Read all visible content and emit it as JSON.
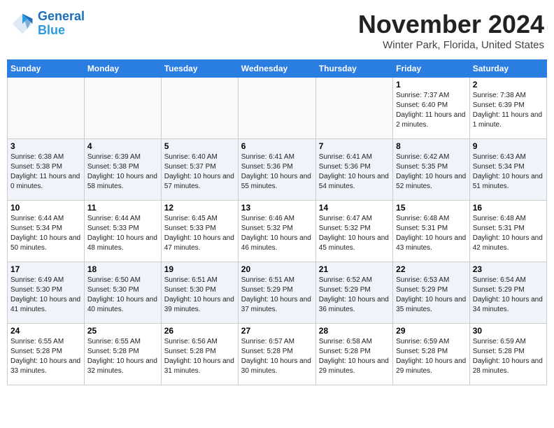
{
  "header": {
    "logo_line1": "General",
    "logo_line2": "Blue",
    "month": "November 2024",
    "location": "Winter Park, Florida, United States"
  },
  "weekdays": [
    "Sunday",
    "Monday",
    "Tuesday",
    "Wednesday",
    "Thursday",
    "Friday",
    "Saturday"
  ],
  "weeks": [
    [
      {
        "day": "",
        "info": ""
      },
      {
        "day": "",
        "info": ""
      },
      {
        "day": "",
        "info": ""
      },
      {
        "day": "",
        "info": ""
      },
      {
        "day": "",
        "info": ""
      },
      {
        "day": "1",
        "info": "Sunrise: 7:37 AM\nSunset: 6:40 PM\nDaylight: 11 hours and 2 minutes."
      },
      {
        "day": "2",
        "info": "Sunrise: 7:38 AM\nSunset: 6:39 PM\nDaylight: 11 hours and 1 minute."
      }
    ],
    [
      {
        "day": "3",
        "info": "Sunrise: 6:38 AM\nSunset: 5:38 PM\nDaylight: 11 hours and 0 minutes."
      },
      {
        "day": "4",
        "info": "Sunrise: 6:39 AM\nSunset: 5:38 PM\nDaylight: 10 hours and 58 minutes."
      },
      {
        "day": "5",
        "info": "Sunrise: 6:40 AM\nSunset: 5:37 PM\nDaylight: 10 hours and 57 minutes."
      },
      {
        "day": "6",
        "info": "Sunrise: 6:41 AM\nSunset: 5:36 PM\nDaylight: 10 hours and 55 minutes."
      },
      {
        "day": "7",
        "info": "Sunrise: 6:41 AM\nSunset: 5:36 PM\nDaylight: 10 hours and 54 minutes."
      },
      {
        "day": "8",
        "info": "Sunrise: 6:42 AM\nSunset: 5:35 PM\nDaylight: 10 hours and 52 minutes."
      },
      {
        "day": "9",
        "info": "Sunrise: 6:43 AM\nSunset: 5:34 PM\nDaylight: 10 hours and 51 minutes."
      }
    ],
    [
      {
        "day": "10",
        "info": "Sunrise: 6:44 AM\nSunset: 5:34 PM\nDaylight: 10 hours and 50 minutes."
      },
      {
        "day": "11",
        "info": "Sunrise: 6:44 AM\nSunset: 5:33 PM\nDaylight: 10 hours and 48 minutes."
      },
      {
        "day": "12",
        "info": "Sunrise: 6:45 AM\nSunset: 5:33 PM\nDaylight: 10 hours and 47 minutes."
      },
      {
        "day": "13",
        "info": "Sunrise: 6:46 AM\nSunset: 5:32 PM\nDaylight: 10 hours and 46 minutes."
      },
      {
        "day": "14",
        "info": "Sunrise: 6:47 AM\nSunset: 5:32 PM\nDaylight: 10 hours and 45 minutes."
      },
      {
        "day": "15",
        "info": "Sunrise: 6:48 AM\nSunset: 5:31 PM\nDaylight: 10 hours and 43 minutes."
      },
      {
        "day": "16",
        "info": "Sunrise: 6:48 AM\nSunset: 5:31 PM\nDaylight: 10 hours and 42 minutes."
      }
    ],
    [
      {
        "day": "17",
        "info": "Sunrise: 6:49 AM\nSunset: 5:30 PM\nDaylight: 10 hours and 41 minutes."
      },
      {
        "day": "18",
        "info": "Sunrise: 6:50 AM\nSunset: 5:30 PM\nDaylight: 10 hours and 40 minutes."
      },
      {
        "day": "19",
        "info": "Sunrise: 6:51 AM\nSunset: 5:30 PM\nDaylight: 10 hours and 39 minutes."
      },
      {
        "day": "20",
        "info": "Sunrise: 6:51 AM\nSunset: 5:29 PM\nDaylight: 10 hours and 37 minutes."
      },
      {
        "day": "21",
        "info": "Sunrise: 6:52 AM\nSunset: 5:29 PM\nDaylight: 10 hours and 36 minutes."
      },
      {
        "day": "22",
        "info": "Sunrise: 6:53 AM\nSunset: 5:29 PM\nDaylight: 10 hours and 35 minutes."
      },
      {
        "day": "23",
        "info": "Sunrise: 6:54 AM\nSunset: 5:29 PM\nDaylight: 10 hours and 34 minutes."
      }
    ],
    [
      {
        "day": "24",
        "info": "Sunrise: 6:55 AM\nSunset: 5:28 PM\nDaylight: 10 hours and 33 minutes."
      },
      {
        "day": "25",
        "info": "Sunrise: 6:55 AM\nSunset: 5:28 PM\nDaylight: 10 hours and 32 minutes."
      },
      {
        "day": "26",
        "info": "Sunrise: 6:56 AM\nSunset: 5:28 PM\nDaylight: 10 hours and 31 minutes."
      },
      {
        "day": "27",
        "info": "Sunrise: 6:57 AM\nSunset: 5:28 PM\nDaylight: 10 hours and 30 minutes."
      },
      {
        "day": "28",
        "info": "Sunrise: 6:58 AM\nSunset: 5:28 PM\nDaylight: 10 hours and 29 minutes."
      },
      {
        "day": "29",
        "info": "Sunrise: 6:59 AM\nSunset: 5:28 PM\nDaylight: 10 hours and 29 minutes."
      },
      {
        "day": "30",
        "info": "Sunrise: 6:59 AM\nSunset: 5:28 PM\nDaylight: 10 hours and 28 minutes."
      }
    ]
  ]
}
